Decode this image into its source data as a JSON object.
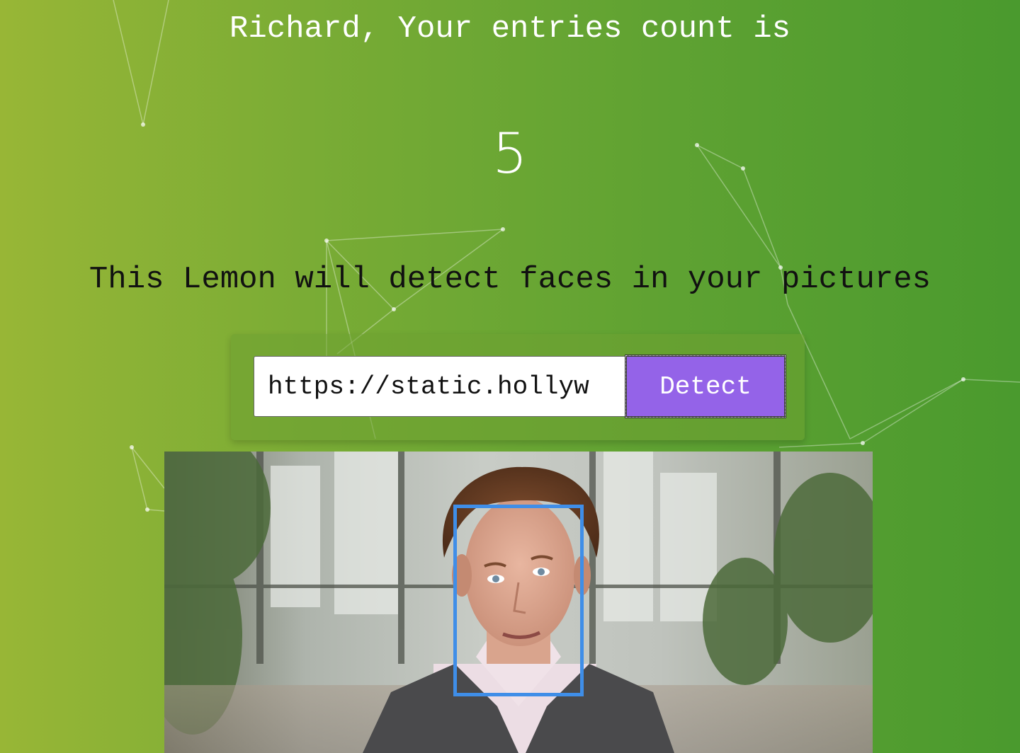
{
  "header": {
    "greeting": "Richard, Your entries count is",
    "entry_count": "5"
  },
  "main": {
    "tagline": "This Lemon will detect faces in your pictures"
  },
  "form": {
    "image_url_value": "https://static.hollyw",
    "detect_label": "Detect"
  },
  "colors": {
    "background_left": "#98b636",
    "background_right": "#4a9a2e",
    "button": "#9463e8",
    "face_box": "#3f8ee8"
  },
  "detected_faces": [
    {
      "label": "face"
    }
  ]
}
